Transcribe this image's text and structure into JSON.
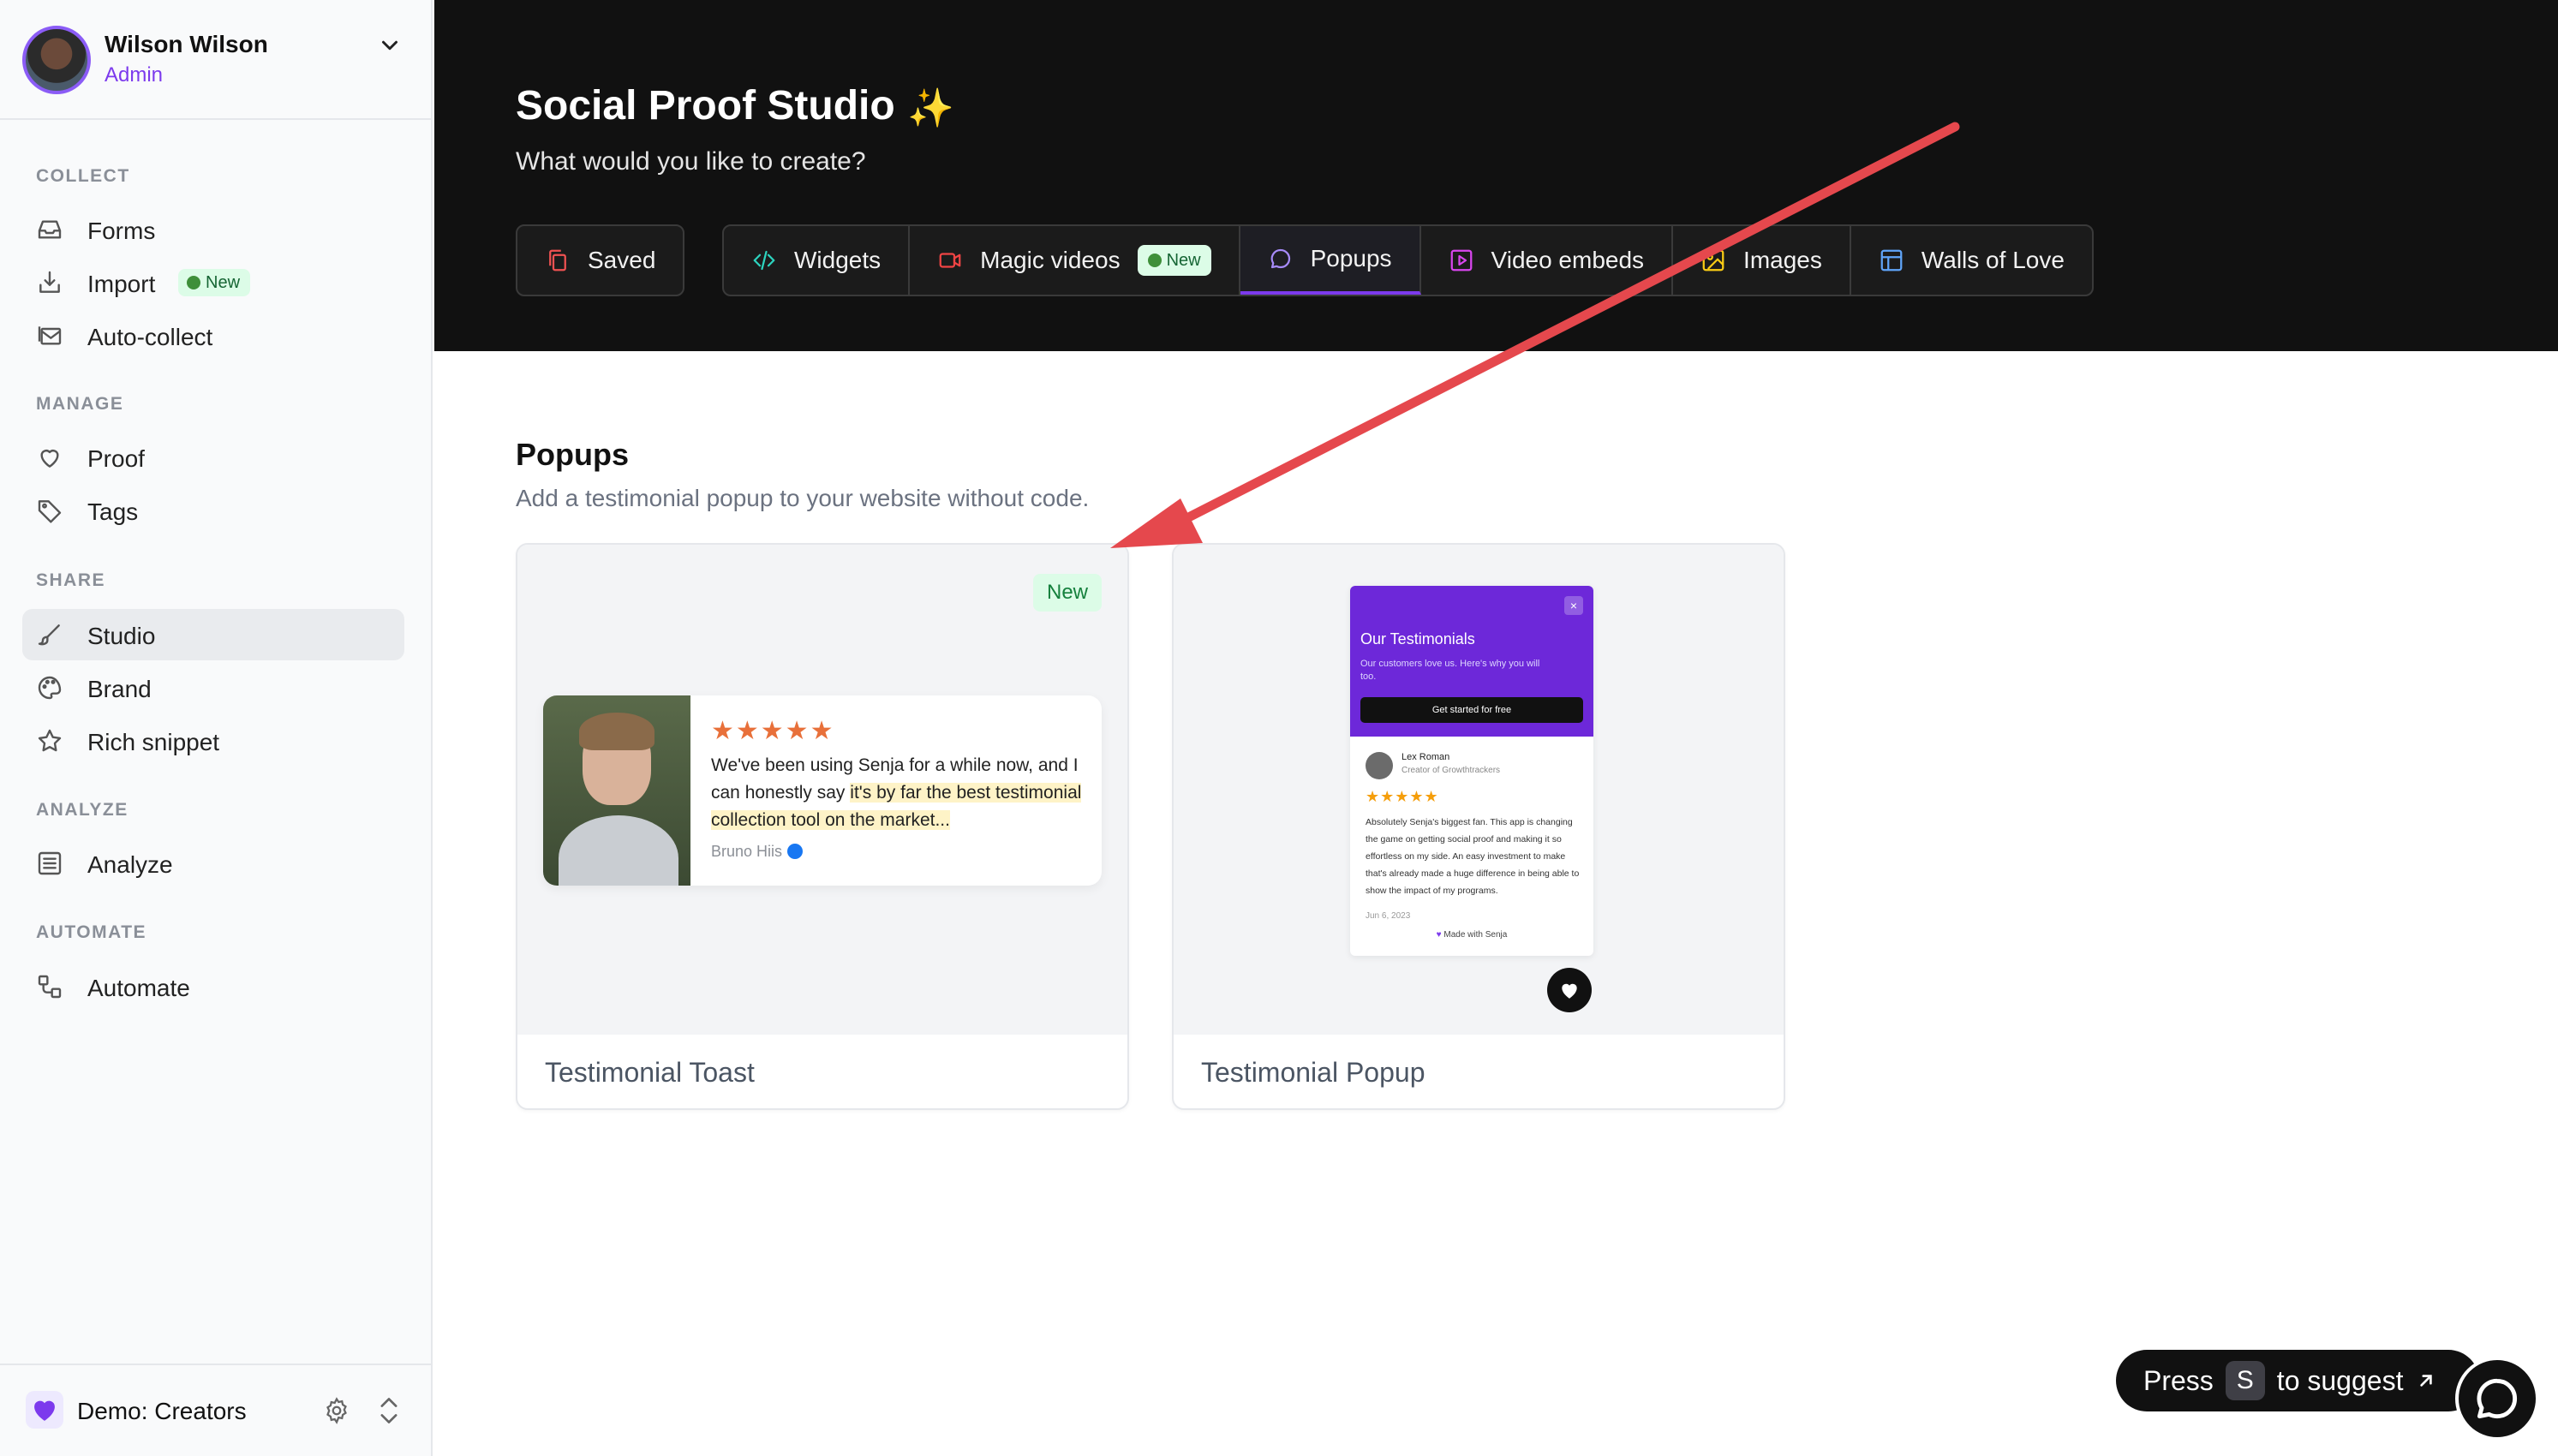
{
  "user": {
    "name": "Wilson Wilson",
    "role": "Admin"
  },
  "sidebar": {
    "sections": {
      "collect": "COLLECT",
      "manage": "MANAGE",
      "share": "SHARE",
      "analyze": "ANALYZE",
      "automate": "AUTOMATE"
    },
    "items": {
      "forms": "Forms",
      "import": "Import",
      "import_badge": "New",
      "auto_collect": "Auto-collect",
      "proof": "Proof",
      "tags": "Tags",
      "studio": "Studio",
      "brand": "Brand",
      "rich_snippet": "Rich snippet",
      "analyze": "Analyze",
      "automate": "Automate"
    },
    "workspace": "Demo: Creators"
  },
  "header": {
    "title": "Social Proof Studio",
    "sparkle": "✨",
    "subtitle": "What would you like to create?",
    "tabs": {
      "saved": "Saved",
      "widgets": "Widgets",
      "magic_videos": "Magic videos",
      "magic_badge": "New",
      "popups": "Popups",
      "video_embeds": "Video embeds",
      "images": "Images",
      "walls_of_love": "Walls of Love"
    },
    "active_tab": "Popups"
  },
  "main": {
    "section_title": "Popups",
    "section_subtitle": "Add a testimonial popup to your website without code.",
    "cards": [
      {
        "label": "Testimonial Toast",
        "badge": "New",
        "stars": "★★★★★",
        "text_before": "We've been using Senja for a while now, and I can honestly say",
        "text_highlight": "it's by far the best testimonial collection tool on the market...",
        "author": "Bruno Hiis"
      },
      {
        "label": "Testimonial Popup",
        "popup_title": "Our Testimonials",
        "popup_subtitle": "Our customers love us. Here's why you will too.",
        "popup_button": "Get started for free",
        "close": "×",
        "reviewer_name": "Lex Roman",
        "reviewer_role": "Creator of Growthtrackers",
        "stars": "★★★★★",
        "review_text": "Absolutely Senja's biggest fan. This app is changing the game on getting social proof and making it so effortless on my side. An easy investment to make that's already made a huge difference in being able to show the impact of my programs.",
        "review_date": "Jun 6, 2023",
        "made_with": "Made with Senja"
      }
    ]
  },
  "suggest": {
    "press": "Press",
    "key": "S",
    "text": "to suggest"
  },
  "colors": {
    "accent": "#7c3aed",
    "header_bg": "#111111",
    "arrow": "#e5484d",
    "new_badge_bg": "#dcfce7"
  }
}
